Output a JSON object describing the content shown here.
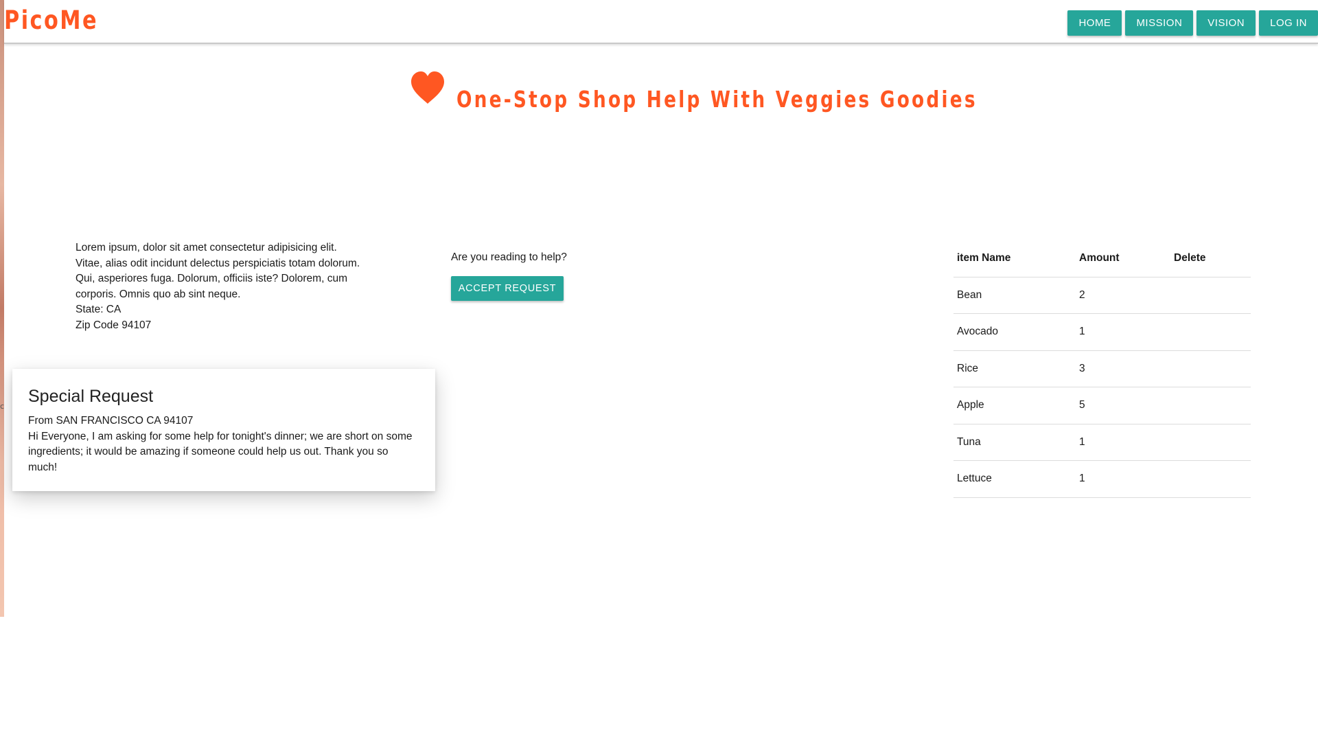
{
  "app": {
    "brand": "PicoMe",
    "edge_mark": "c"
  },
  "nav": {
    "items": [
      {
        "label": "HOME"
      },
      {
        "label": "MISSION"
      },
      {
        "label": "VISION"
      },
      {
        "label": "LOG IN"
      }
    ]
  },
  "hero": {
    "icon": "heart-icon",
    "title": "One-Stop Shop Help With Veggies Goodies"
  },
  "description": {
    "lines": [
      "Lorem ipsum, dolor sit amet consectetur adipisicing elit.",
      "Vitae, alias odit incidunt delectus perspiciatis totam dolorum.",
      "Qui, asperiores fuga. Dolorum, officiis iste? Dolorem, cum",
      "corporis. Omnis quo ab sint neque."
    ],
    "state": "State: CA",
    "zip": "Zip Code 94107"
  },
  "help": {
    "question": "Are you reading to help?",
    "accept_label": "ACCEPT REQUEST"
  },
  "special_request": {
    "title": "Special Request",
    "from": "From SAN FRANCISCO CA 94107",
    "message": "Hi Everyone, I am asking for some help for tonight's dinner; we are short on some ingredients; it would be amazing if someone could help us out. Thank you so much!"
  },
  "items": {
    "columns": [
      "item Name",
      "Amount",
      "Delete"
    ],
    "rows": [
      {
        "name": "Bean",
        "amount": "2"
      },
      {
        "name": "Avocado",
        "amount": "1"
      },
      {
        "name": "Rice",
        "amount": "3"
      },
      {
        "name": "Apple",
        "amount": "5"
      },
      {
        "name": "Tuna",
        "amount": "1"
      },
      {
        "name": "Lettuce",
        "amount": "1"
      }
    ]
  },
  "colors": {
    "brand": "#ff5722",
    "button": "#26a69a"
  }
}
